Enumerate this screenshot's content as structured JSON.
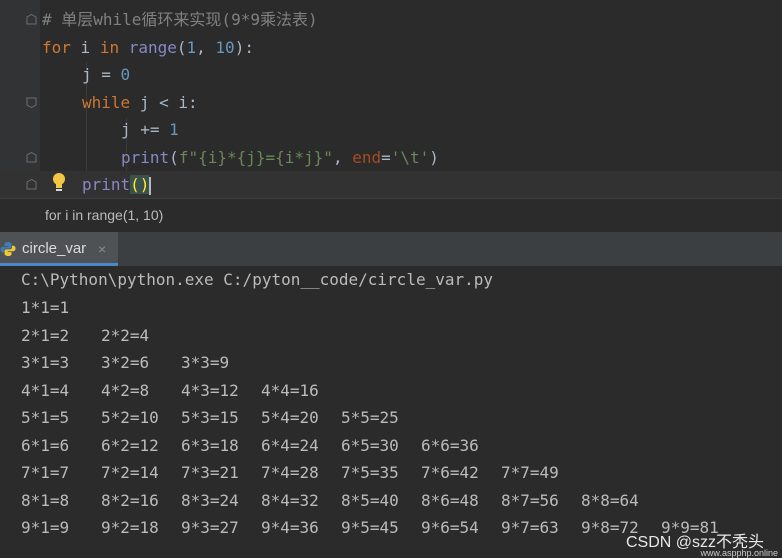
{
  "editor": {
    "lines": {
      "comment": "# 单层while循环来实现(9*9乘法表)",
      "l2_kw_for": "for",
      "l2_var": " i ",
      "l2_kw_in": "in",
      "l2_fn_range": " range",
      "l2_open": "(",
      "l2_n1": "1",
      "l2_sep": ", ",
      "l2_n2": "10",
      "l2_close": "):",
      "l3_text": "j = ",
      "l3_num": "0",
      "l4_kw": "while",
      "l4_text": " j < i:",
      "l5_text": "j += ",
      "l5_num": "1",
      "l6_fn": "print",
      "l6_open": "(",
      "l6_fstr": "f\"{i}*{j}={i*j}\"",
      "l6_sep": ", ",
      "l6_kw": "end",
      "l6_eq": "=",
      "l6_str": "'\\t'",
      "l6_close": ")",
      "l7_fn": "print",
      "l7_parens": "()"
    }
  },
  "breadcrumb": {
    "text": "for i in range(1, 10)"
  },
  "run_tab": {
    "label": "circle_var",
    "close_symbol": "×"
  },
  "console": {
    "command": "C:\\Python\\python.exe C:/pyton__code/circle_var.py",
    "rows": [
      [
        "1*1=1"
      ],
      [
        "2*1=2",
        "2*2=4"
      ],
      [
        "3*1=3",
        "3*2=6",
        "3*3=9"
      ],
      [
        "4*1=4",
        "4*2=8",
        "4*3=12",
        "4*4=16"
      ],
      [
        "5*1=5",
        "5*2=10",
        "5*3=15",
        "5*4=20",
        "5*5=25"
      ],
      [
        "6*1=6",
        "6*2=12",
        "6*3=18",
        "6*4=24",
        "6*5=30",
        "6*6=36"
      ],
      [
        "7*1=7",
        "7*2=14",
        "7*3=21",
        "7*4=28",
        "7*5=35",
        "7*6=42",
        "7*7=49"
      ],
      [
        "8*1=8",
        "8*2=16",
        "8*3=24",
        "8*4=32",
        "8*5=40",
        "8*6=48",
        "8*7=56",
        "8*8=64"
      ],
      [
        "9*1=9",
        "9*2=18",
        "9*3=27",
        "9*4=36",
        "9*5=45",
        "9*6=54",
        "9*7=63",
        "9*8=72",
        "9*9=81"
      ]
    ]
  },
  "watermark": {
    "text": "CSDN @szz不秃头",
    "sub": "www.aspphp.online"
  },
  "colors": {
    "keyword": "#cc7832",
    "number": "#6897bb",
    "string": "#6a8759",
    "builtin": "#8888c6",
    "comment": "#808080"
  }
}
